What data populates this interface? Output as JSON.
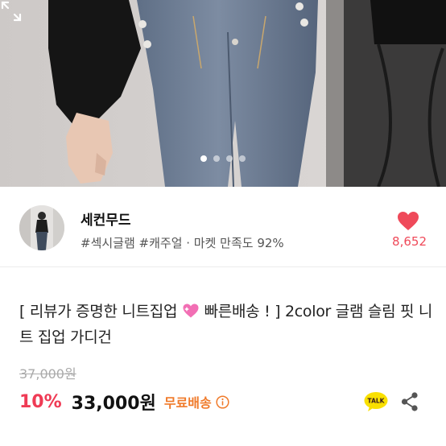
{
  "hero": {
    "dots_total": 4,
    "dots_active_index": 0,
    "expand_icon": "expand-icon"
  },
  "seller": {
    "name": "세컨무드",
    "tags": "#섹시글램 #캐주얼 · 마켓 만족도 92%",
    "like_icon": "heart-icon",
    "like_count": "8,652"
  },
  "product": {
    "title_part1": "[ 리뷰가 증명한 니트집업 ",
    "title_emoji": "sparkling-heart",
    "title_part2": " 빠른배송 ! ] 2color  글램 슬림 핏 니트 집업 가디건",
    "original_price": "37,000원",
    "discount": "10%",
    "price": "33,000원",
    "shipping": "무료배송",
    "shipping_info_icon": "info-icon",
    "talk_label": "TALK",
    "share_icon": "share-icon"
  },
  "colors": {
    "accent_red": "#ef3b55",
    "like_red": "#ef4a5a",
    "shipping_orange": "#f07a2a",
    "talk_yellow": "#f9e000"
  }
}
